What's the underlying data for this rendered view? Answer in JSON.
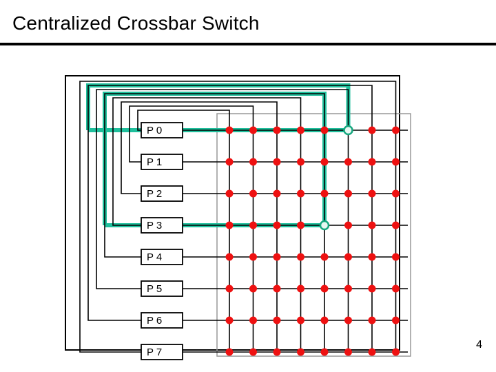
{
  "title": "Centralized Crossbar Switch",
  "page_number": "4",
  "ports": [
    "P 0",
    "P 1",
    "P 2",
    "P 3",
    "P 4",
    "P 5",
    "P 6",
    "P 7"
  ],
  "highlighted_crosspoints": [
    {
      "row": 0,
      "col": 5
    },
    {
      "row": 3,
      "col": 4
    }
  ],
  "chart_data": {
    "type": "diagram",
    "description": "8x8 centralized crossbar switch. Eight ports P0..P7 on the left connect via horizontal and vertical lines to an 8x8 grid of crosspoint switches. Two crosspoints are highlighted (green): (P0, column 5) and (P3, column 4). All other crosspoints are solid red dots. Thick green paths show two example connections from ports through the crossbar back around to the feedback bus.",
    "ports": [
      "P0",
      "P1",
      "P2",
      "P3",
      "P4",
      "P5",
      "P6",
      "P7"
    ],
    "grid": {
      "rows": 8,
      "cols": 8
    },
    "active_connections": [
      {
        "from_port": "P0",
        "to_column": 5
      },
      {
        "from_port": "P3",
        "to_column": 4
      }
    ]
  }
}
